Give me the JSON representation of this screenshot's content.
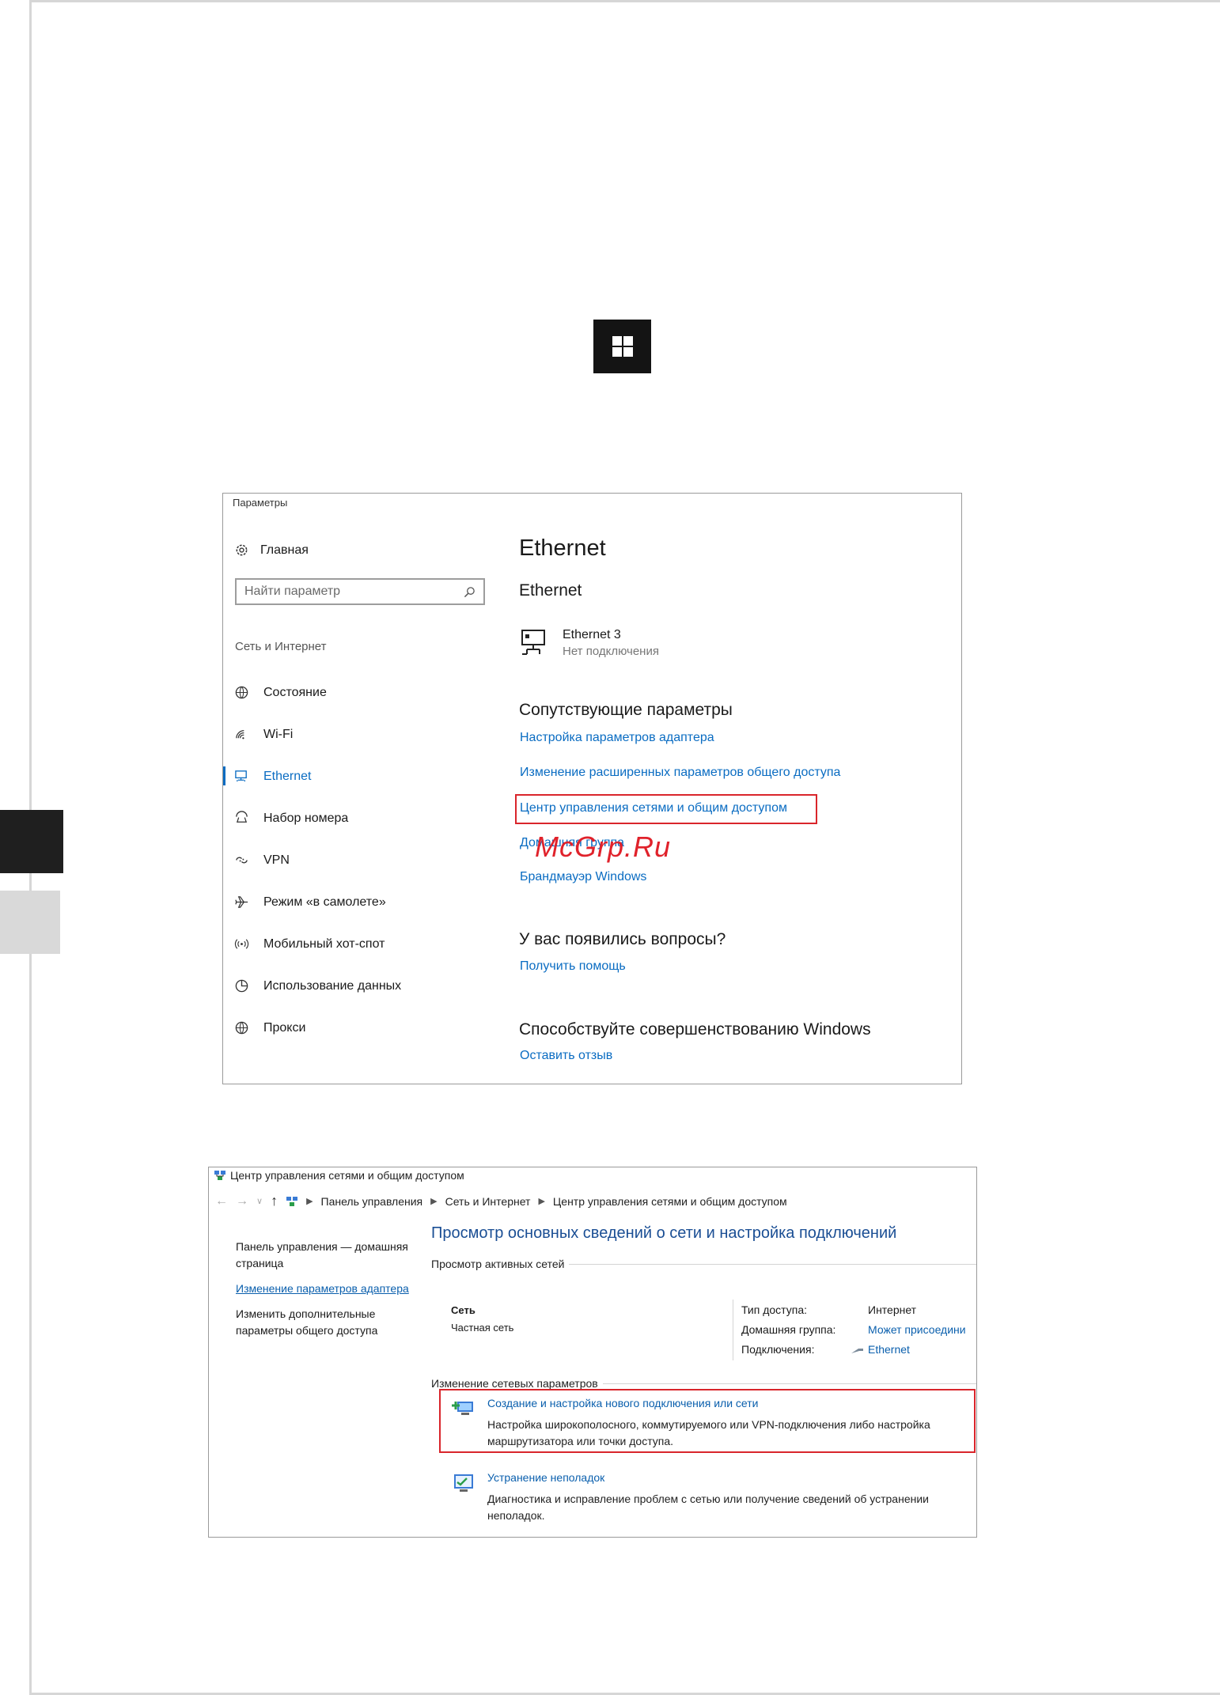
{
  "settings": {
    "window_title": "Параметры",
    "home_label": "Главная",
    "search_placeholder": "Найти параметр",
    "section_label": "Сеть и Интернет",
    "nav": [
      {
        "label": "Состояние",
        "icon": "globe-status-icon"
      },
      {
        "label": "Wi-Fi",
        "icon": "wifi-icon"
      },
      {
        "label": "Ethernet",
        "icon": "ethernet-icon"
      },
      {
        "label": "Набор номера",
        "icon": "dialup-icon"
      },
      {
        "label": "VPN",
        "icon": "vpn-icon"
      },
      {
        "label": "Режим «в самолете»",
        "icon": "airplane-icon"
      },
      {
        "label": "Мобильный хот-спот",
        "icon": "hotspot-icon"
      },
      {
        "label": "Использование данных",
        "icon": "data-usage-icon"
      },
      {
        "label": "Прокси",
        "icon": "globe-icon"
      }
    ],
    "active_nav": "Ethernet",
    "main": {
      "title": "Ethernet",
      "subtitle": "Ethernet",
      "adapter_name": "Ethernet 3",
      "adapter_status": "Нет подключения",
      "related_heading": "Сопутствующие параметры",
      "related_links": [
        "Настройка параметров адаптера",
        "Изменение расширенных параметров общего доступа",
        "Центр управления сетями и общим доступом",
        "Домашняя группа",
        "Брандмауэр Windows"
      ],
      "questions_heading": "У вас появились вопросы?",
      "help_link": "Получить помощь",
      "improve_heading": "Способствуйте совершенствованию Windows",
      "feedback_link": "Оставить отзыв"
    }
  },
  "watermark": "McGrp.Ru",
  "netcenter": {
    "window_title": "Центр управления сетями и общим доступом",
    "breadcrumb": [
      "Панель управления",
      "Сеть и Интернет",
      "Центр управления сетями и общим доступом"
    ],
    "side": [
      "Панель управления — домашняя страница",
      "Изменение параметров адаптера",
      "Изменить дополнительные параметры общего доступа"
    ],
    "heading": "Просмотр основных сведений о сети и настройка подключений",
    "active_networks_label": "Просмотр активных сетей",
    "network_name": "Сеть",
    "network_type": "Частная сеть",
    "props": [
      {
        "key": "Тип доступа:",
        "value": "Интернет"
      },
      {
        "key": "Домашняя группа:",
        "value": "Может присоедини"
      },
      {
        "key": "Подключения:",
        "value": "Ethernet"
      }
    ],
    "change_settings_label": "Изменение сетевых параметров",
    "tasks": [
      {
        "title": "Создание и настройка нового подключения или сети",
        "desc": "Настройка широкополосного, коммутируемого или VPN-подключения либо настройка маршрутизатора или точки доступа."
      },
      {
        "title": "Устранение неполадок",
        "desc": "Диагностика и исправление проблем с сетью или получение сведений об устранении неполадок."
      }
    ]
  },
  "colors": {
    "link": "#0a6cc2",
    "highlight": "#d9252b",
    "heading_blue": "#1a4e94"
  }
}
